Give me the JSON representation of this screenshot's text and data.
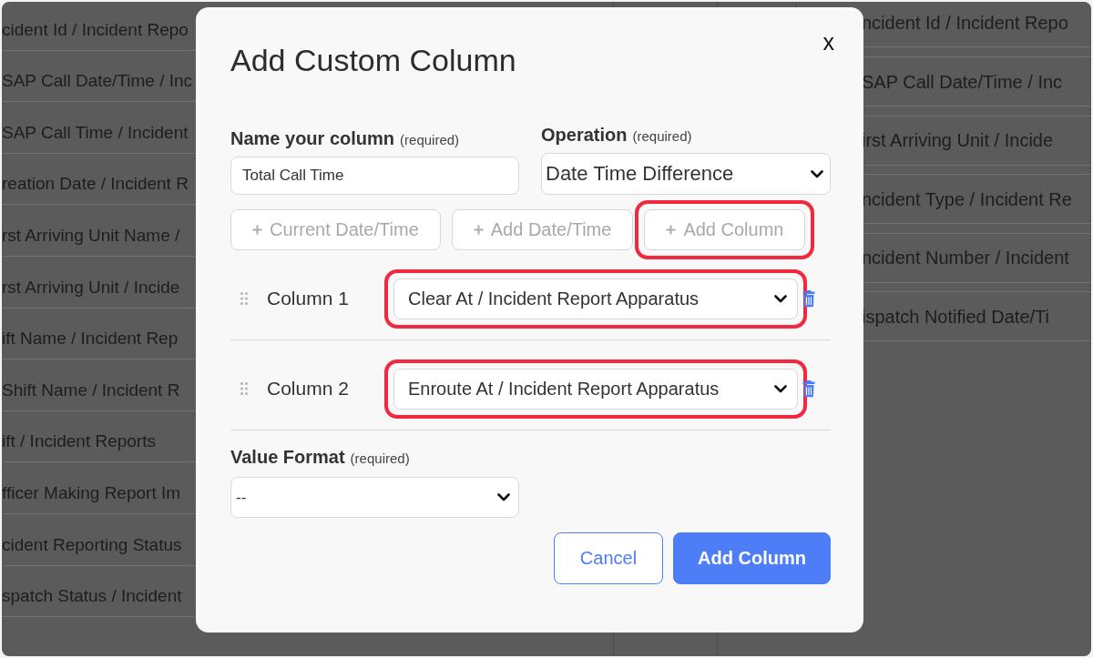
{
  "background": {
    "left_list": [
      "cident Id / Incident Repo",
      "SAP Call Date/Time / Inc",
      "SAP Call Time / Incident",
      "reation Date / Incident R",
      "rst Arriving Unit Name /",
      "rst Arriving Unit / Incide",
      "ift Name / Incident Rep",
      "Shift Name / Incident R",
      "ift / Incident Reports",
      "fficer Making Report Im",
      "cident Reporting Status",
      "spatch Status / Incident"
    ],
    "right_list": [
      "ncident Id / Incident Repo",
      "SAP Call Date/Time / Inc",
      "irst Arriving Unit / Incide",
      "ncident Type / Incident Re",
      "ncident Number / Incident",
      "ispatch Notified Date/Ti"
    ]
  },
  "dialog": {
    "title": "Add Custom Column",
    "close": "x",
    "name_field": {
      "label": "Name your column",
      "hint": "(required)",
      "value": "Total Call Time"
    },
    "operation_field": {
      "label": "Operation",
      "hint": "(required)",
      "value": "Date Time Difference"
    },
    "action_buttons": [
      {
        "label": "Current Date/Time",
        "disabled": true,
        "highlighted": false
      },
      {
        "label": "Add Date/Time",
        "disabled": true,
        "highlighted": false
      },
      {
        "label": "Add Column",
        "disabled": true,
        "highlighted": true
      }
    ],
    "columns": [
      {
        "label": "Column 1",
        "value": "Clear At / Incident Report Apparatus",
        "highlighted": true
      },
      {
        "label": "Column 2",
        "value": "Enroute At / Incident Report Apparatus",
        "highlighted": true
      }
    ],
    "value_format": {
      "label": "Value Format",
      "hint": "(required)",
      "value": "--"
    },
    "buttons": [
      {
        "label": "Cancel",
        "kind": "secondary"
      },
      {
        "label": "Add Column",
        "kind": "primary"
      }
    ]
  }
}
